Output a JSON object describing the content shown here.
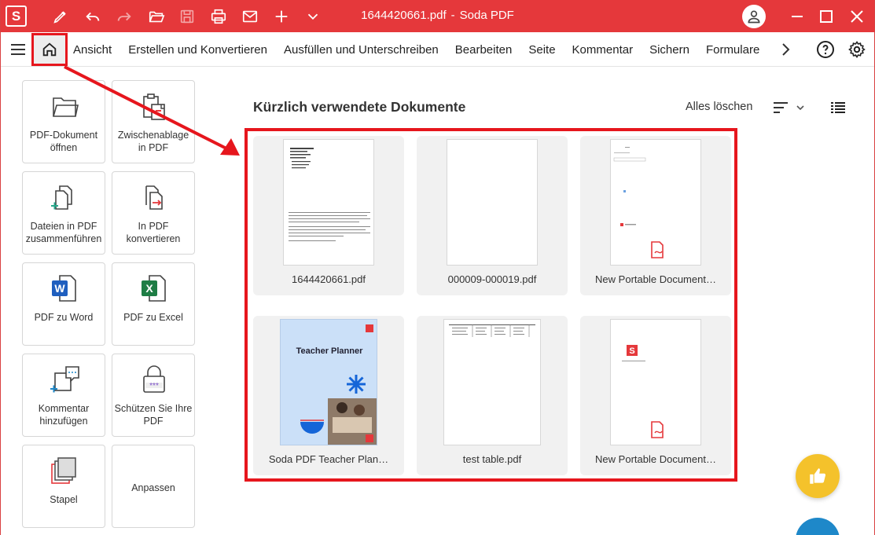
{
  "app": {
    "logo_letter": "S",
    "title_file": "1644420661.pdf",
    "title_sep": "-",
    "title_app": "Soda PDF",
    "accent": "#e5383b"
  },
  "menu": {
    "items": [
      "Ansicht",
      "Erstellen und Konvertieren",
      "Ausfüllen und Unterschreiben",
      "Bearbeiten",
      "Seite",
      "Kommentar",
      "Sichern",
      "Formulare"
    ]
  },
  "sidebar": {
    "tiles": [
      {
        "label": "PDF-Dokument öffnen",
        "icon": "folder-icon"
      },
      {
        "label": "Zwischenablage in PDF",
        "icon": "clipboard-icon"
      },
      {
        "label": "Dateien in PDF zusammenführen",
        "icon": "merge-icon"
      },
      {
        "label": "In PDF konvertieren",
        "icon": "convert-icon"
      },
      {
        "label": "PDF zu Word",
        "icon": "word-icon"
      },
      {
        "label": "PDF zu Excel",
        "icon": "excel-icon"
      },
      {
        "label": "Kommentar hinzufügen",
        "icon": "comment-icon"
      },
      {
        "label": "Schützen Sie Ihre PDF",
        "icon": "lock-icon"
      },
      {
        "label": "Stapel",
        "icon": "stack-icon"
      },
      {
        "label": "Anpassen",
        "icon": ""
      }
    ]
  },
  "main": {
    "title": "Kürzlich verwendete Dokumente",
    "clear_all": "Alles löschen",
    "documents": [
      {
        "name": "1644420661.pdf",
        "thumb": "text"
      },
      {
        "name": "000009-000019.pdf",
        "thumb": "blank"
      },
      {
        "name": "New Portable Document…",
        "thumb": "form"
      },
      {
        "name": "Soda PDF Teacher Plan…",
        "thumb": "planner",
        "thumb_title": "Teacher Planner"
      },
      {
        "name": "test table.pdf",
        "thumb": "table"
      },
      {
        "name": "New Portable Document…",
        "thumb": "logo"
      }
    ]
  }
}
